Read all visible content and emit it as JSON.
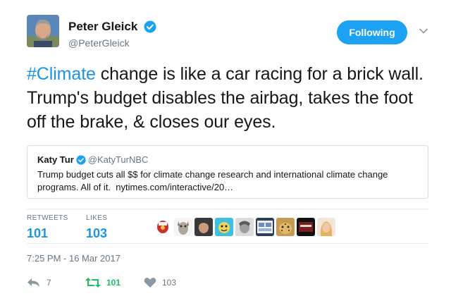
{
  "author": {
    "name": "Peter Gleick",
    "handle": "@PeterGleick",
    "verified": true
  },
  "follow_button": {
    "label": "Following"
  },
  "tweet": {
    "hashtag": "#Climate",
    "text_after_hashtag": " change is like a car racing for a brick wall. Trump's budget disables the airbag, takes the foot off the brake, & closes our eyes."
  },
  "quoted_tweet": {
    "name": "Katy Tur",
    "handle": "@KatyTurNBC",
    "verified": true,
    "text": "Trump budget cuts all $$ for climate change research and international climate change programs. All of it.",
    "link": "nytimes.com/interactive/20…"
  },
  "stats": {
    "retweets_label": "RETWEETS",
    "retweets_value": "101",
    "likes_label": "LIKES",
    "likes_value": "103"
  },
  "likers": [
    "liker-avatar-1",
    "liker-avatar-2",
    "liker-avatar-3",
    "liker-avatar-4",
    "liker-avatar-5",
    "liker-avatar-6",
    "liker-avatar-7",
    "liker-avatar-8",
    "liker-avatar-9"
  ],
  "timestamp": "7:25 PM - 16 Mar 2017",
  "actions": {
    "reply_count": "7",
    "retweet_count": "101",
    "like_count": "103"
  },
  "colors": {
    "accent_blue": "#1da1f2",
    "link_blue": "#1b95e0",
    "retweet_green": "#17bf63",
    "muted_gray": "#657786"
  },
  "icons": {
    "verified": "verified-badge-icon",
    "caret": "chevron-down-icon",
    "reply": "reply-icon",
    "retweet": "retweet-icon",
    "like": "heart-icon"
  }
}
